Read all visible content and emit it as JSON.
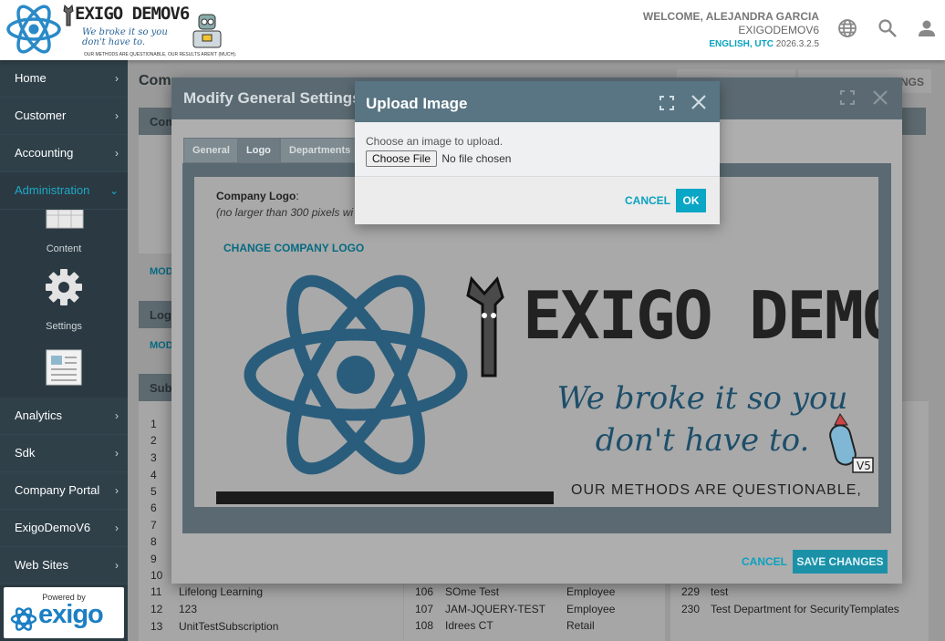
{
  "header": {
    "logo_title": "EXIGO DEMOV6",
    "logo_tagline": "We broke it so you don't have to.",
    "logo_small": "OUR METHODS ARE QUESTIONABLE, OUR RESULTS AREN'T (MUCH).",
    "welcome": "WELCOME, ALEJANDRA GARCIA",
    "company": "EXIGODEMOV6",
    "lang": "ENGLISH, UTC",
    "version": "2026.3.2.5",
    "icons": [
      "globe-icon",
      "search-icon",
      "user-icon"
    ]
  },
  "sidebar": {
    "items": [
      {
        "label": "Home"
      },
      {
        "label": "Customer"
      },
      {
        "label": "Accounting"
      },
      {
        "label": "Administration"
      },
      {
        "label": "Analytics"
      },
      {
        "label": "Sdk"
      },
      {
        "label": "Company Portal"
      },
      {
        "label": "ExigoDemoV6"
      },
      {
        "label": "Web Sites"
      }
    ],
    "subitems": [
      {
        "label": "Content"
      },
      {
        "label": "Settings"
      }
    ],
    "powered_by": "Powered by",
    "powered_brand": "exigo"
  },
  "background": {
    "page_title": "Com",
    "right_button": "NGS",
    "card_head_1": "Com",
    "card_link_1": "MOD",
    "card_head_2": "Logo",
    "card_link_2": "MOD",
    "card_head_3": "Subs",
    "rows_left_nums": [
      "1",
      "2",
      "3",
      "4",
      "5",
      "6",
      "7",
      "8",
      "9",
      "10"
    ],
    "list_left": [
      {
        "num": "11",
        "name": "Lifelong Learning"
      },
      {
        "num": "12",
        "name": "123"
      },
      {
        "num": "13",
        "name": "UnitTestSubscription"
      }
    ],
    "list_mid": [
      {
        "num": "106",
        "name": "SOme Test",
        "type": "Employee"
      },
      {
        "num": "107",
        "name": "JAM-JQUERY-TEST",
        "type": "Employee"
      },
      {
        "num": "108",
        "name": "Idrees CT",
        "type": "Retail"
      }
    ],
    "list_right": [
      {
        "num": "229",
        "name": "test"
      },
      {
        "num": "230",
        "name": "Test Department for SecurityTemplates"
      }
    ]
  },
  "settings_modal": {
    "title": "Modify General Settings",
    "tabs": [
      "General",
      "Logo",
      "Departments"
    ],
    "active_tab": "Logo",
    "logo_label": "Company Logo",
    "logo_hint": "(no larger than 300 pixels wi",
    "change_logo": "CHANGE COMPANY LOGO",
    "preview_title": "EXIGO DEMOV6",
    "preview_tagline_1": "We broke it so you",
    "preview_tagline_2": "don't have to.",
    "preview_small": "OUR METHODS ARE QUESTIONABLE,",
    "cancel": "CANCEL",
    "save": "SAVE CHANGES"
  },
  "upload_modal": {
    "title": "Upload Image",
    "prompt": "Choose an image to upload.",
    "choose_file": "Choose File",
    "no_file": "No file chosen",
    "cancel": "CANCEL",
    "ok": "OK"
  },
  "colors": {
    "accent": "#0aa2c0",
    "sidebar": "#2b3a42",
    "header_bar": "#597583"
  }
}
